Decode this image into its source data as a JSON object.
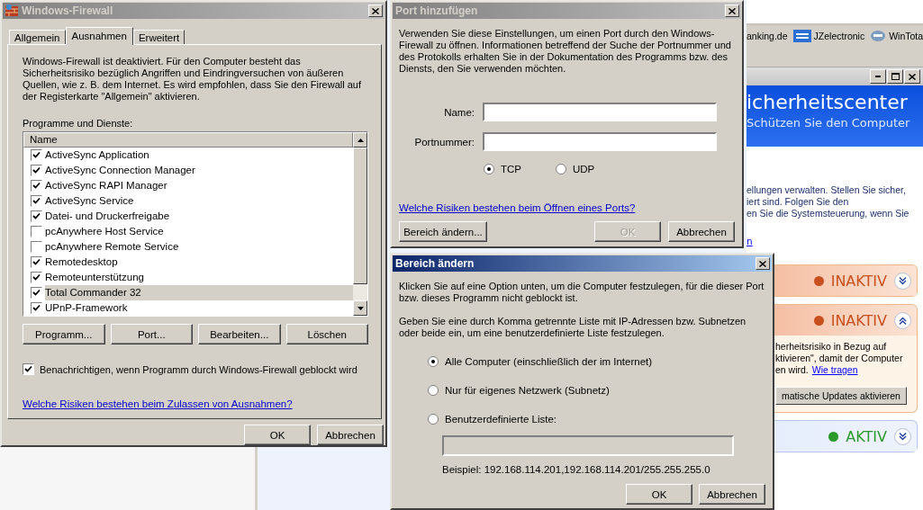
{
  "background_window": {
    "bookmarks": [
      {
        "label": "anking.de",
        "kind": "plain"
      },
      {
        "label": "JZelectronic",
        "kind": "jz"
      },
      {
        "label": "WinTota",
        "kind": "wt"
      }
    ],
    "header_title": "icherheitscenter",
    "header_subtitle": "Schützen Sie den Computer",
    "text_lines": [
      "ellungen verwalten. Stellen Sie sicher,",
      "iert sind. Folgen Sie den",
      "en Sie die Systemsteuerung, wenn Sie"
    ],
    "link": "n",
    "cards": [
      {
        "status": "INAKTIV",
        "color": "#c8501e",
        "expanded": false
      },
      {
        "status": "INAKTIV",
        "color": "#c8501e",
        "expanded": true,
        "text_lines": [
          "herheitsrisiko in Bezug auf",
          "ktivieren\", damit der Computer"
        ],
        "last_line": "en wird.",
        "link": "Wie tragen",
        "button": "matische Updates aktivieren"
      },
      {
        "status": "AKTIV",
        "color": "#2a9a2a",
        "expanded": false
      }
    ]
  },
  "firewall_window": {
    "title": "Windows-Firewall",
    "tabs": [
      {
        "label": "Allgemein",
        "selected": false
      },
      {
        "label": "Ausnahmen",
        "selected": true
      },
      {
        "label": "Erweitert",
        "selected": false
      }
    ],
    "warning_text": "Windows-Firewall ist deaktiviert. Für den Computer besteht das Sicherheitsrisiko bezüglich Angriffen und Eindringversuchen von äußeren Quellen, wie z. B. dem Internet. Es wird empfohlen, dass Sie den Firewall auf der Registerkarte \"Allgemein\" aktivieren.",
    "list_label": "Programme und Dienste:",
    "column_header": "Name",
    "programs": [
      {
        "name": "ActiveSync Application",
        "checked": true,
        "selected": false
      },
      {
        "name": "ActiveSync Connection Manager",
        "checked": true,
        "selected": false
      },
      {
        "name": "ActiveSync RAPI Manager",
        "checked": true,
        "selected": false
      },
      {
        "name": "ActiveSync Service",
        "checked": true,
        "selected": false
      },
      {
        "name": "Datei- und Druckerfreigabe",
        "checked": true,
        "selected": false
      },
      {
        "name": "pcAnywhere Host Service",
        "checked": false,
        "selected": false
      },
      {
        "name": "pcAnywhere Remote Service",
        "checked": false,
        "selected": false
      },
      {
        "name": "Remotedesktop",
        "checked": true,
        "selected": false
      },
      {
        "name": "Remoteunterstützung",
        "checked": true,
        "selected": false
      },
      {
        "name": "Total Commander 32",
        "checked": true,
        "selected": true
      },
      {
        "name": "UPnP-Framework",
        "checked": true,
        "selected": false
      }
    ],
    "action_buttons": [
      "Programm...",
      "Port...",
      "Bearbeiten...",
      "Löschen"
    ],
    "notify": {
      "label": "Benachrichtigen, wenn Programm durch Windows-Firewall geblockt wird",
      "checked": true
    },
    "help_link": "Welche Risiken bestehen beim Zulassen von Ausnahmen?",
    "buttons": [
      "OK",
      "Abbrechen"
    ]
  },
  "port_dialog": {
    "title": "Port hinzufügen",
    "intro": "Verwenden Sie diese Einstellungen, um einen Port durch den Windows-Firewall zu öffnen. Informationen betreffend der Suche der Portnummer und des Protokolls erhalten Sie in der Dokumentation des Programms bzw. des Diensts, den Sie verwenden möchten.",
    "fields": [
      {
        "label": "Name:"
      },
      {
        "label": "Portnummer:"
      }
    ],
    "protocols": [
      {
        "label": "TCP",
        "selected": true
      },
      {
        "label": "UDP",
        "selected": false
      }
    ],
    "help_link": "Welche Risiken bestehen beim Öffnen eines Ports?",
    "scope_button": "Bereich ändern...",
    "buttons": [
      {
        "label": "OK",
        "disabled": true
      },
      {
        "label": "Abbrechen",
        "disabled": false
      }
    ]
  },
  "scope_dialog": {
    "title": "Bereich ändern",
    "intro": "Klicken Sie auf eine Option unten, um die Computer festzulegen, für die dieser Port bzw. dieses Programm nicht geblockt ist.",
    "instructions": "Geben Sie eine durch Komma getrennte Liste mit IP-Adressen bzw. Subnetzen oder beide ein, um eine benutzerdefinierte Liste festzulegen.",
    "options": [
      {
        "label": "Alle Computer (einschließlich der im Internet)",
        "selected": true
      },
      {
        "label": "Nur für eigenes Netzwerk (Subnetz)",
        "selected": false
      },
      {
        "label": "Benutzerdefinierte Liste:",
        "selected": false
      }
    ],
    "example": "Beispiel: 192.168.114.201,192.168.114.201/255.255.255.0",
    "buttons": [
      "OK",
      "Abbrechen"
    ]
  }
}
